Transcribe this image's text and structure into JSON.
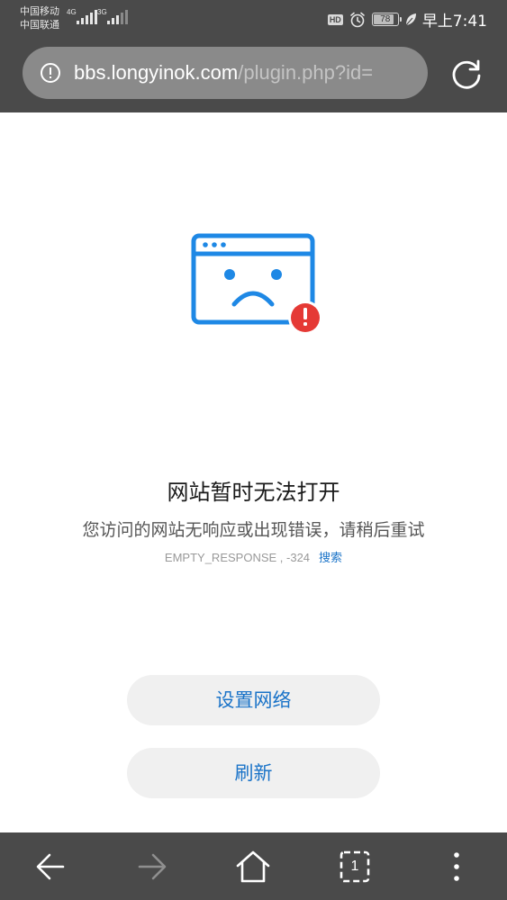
{
  "status_bar": {
    "carrier_1": "中国移动",
    "carrier_2": "中国联通",
    "network_1": "4G",
    "network_2": "3G",
    "hd_label": "HD",
    "battery_level": "78",
    "battery_fraction": 0.78,
    "time": "早上7:41",
    "icons": [
      "signal-bars-icon",
      "alarm-clock-icon",
      "battery-icon",
      "leaf-icon"
    ]
  },
  "address_bar": {
    "url_host": "bbs.longyinok.com",
    "url_path": "/plugin.php?id=",
    "info_icon": "info-circle-icon",
    "reload_icon": "reload-icon"
  },
  "error_page": {
    "title": "网站暂时无法打开",
    "description": "您访问的网站无响应或出现错误，请稍后重试",
    "error_code": "EMPTY_RESPONSE , -324",
    "search_link": "搜索",
    "illustration": "sad-browser-window-icon",
    "buttons": {
      "network_settings": "设置网络",
      "refresh": "刷新"
    }
  },
  "bottom_nav": {
    "tab_count": "1",
    "icons": [
      "back-arrow-icon",
      "forward-arrow-icon",
      "home-icon",
      "tabs-icon",
      "more-menu-icon"
    ]
  },
  "colors": {
    "chrome_bg": "#4a4a4a",
    "url_pill_bg": "#8a8a8a",
    "accent_blue": "#1a73c8",
    "illustration_blue": "#1e88e5",
    "alert_red": "#e53935",
    "button_bg": "#f0f0f0"
  }
}
